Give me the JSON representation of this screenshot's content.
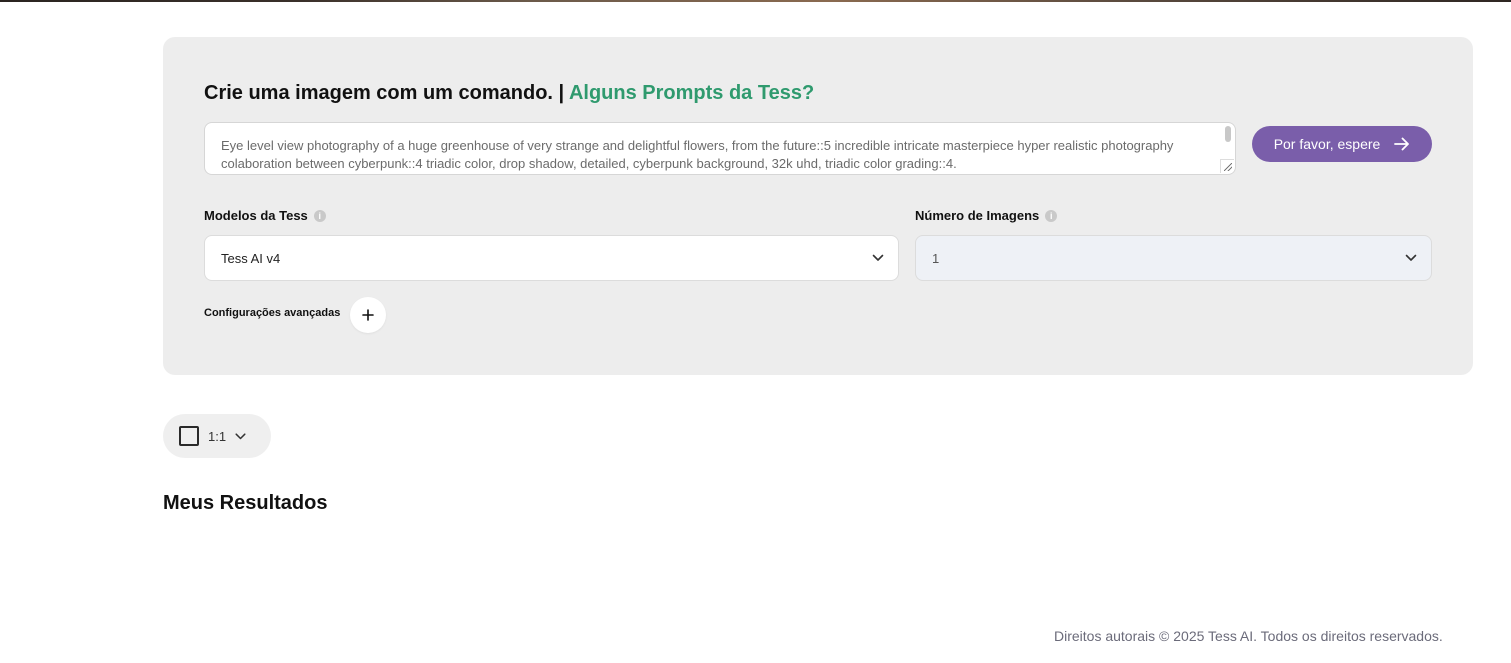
{
  "header": {
    "title": "Crie uma imagem com um comando. | ",
    "link": "Alguns Prompts da Tess?"
  },
  "prompt": {
    "value": "Eye level view photography of a huge greenhouse of very strange and delightful flowers, from the future::5 incredible intricate masterpiece hyper realistic photography colaboration between cyberpunk::4 triadic color, drop shadow, detailed, cyberpunk background, 32k uhd, triadic color grading::4."
  },
  "submit": {
    "label": "Por favor, espere"
  },
  "models": {
    "label": "Modelos da Tess",
    "selected": "Tess AI v4"
  },
  "image_count": {
    "label": "Número de Imagens",
    "selected": "1"
  },
  "advanced": {
    "label": "Configurações avançadas"
  },
  "aspect_ratio": {
    "selected": "1:1"
  },
  "results": {
    "title": "Meus Resultados"
  },
  "footer": {
    "copyright": "Direitos autorais © 2025 Tess AI. Todos os direitos reservados."
  },
  "colors": {
    "accent": "#7a5eaa",
    "link": "#2f9a6e",
    "panel_bg": "#ededed"
  },
  "icons": {
    "submit": "arrow-right-icon",
    "select": "chevron-down-icon",
    "info": "info-icon",
    "advanced": "plus-icon",
    "ratio": "square-icon"
  }
}
